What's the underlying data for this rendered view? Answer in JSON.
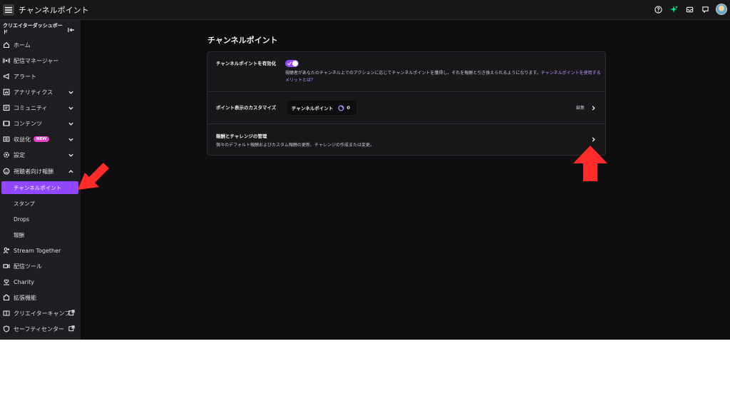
{
  "app": {
    "title": "チャンネルポイント"
  },
  "sidebar": {
    "header": "クリエイターダッシュボード",
    "items": [
      {
        "label": "ホーム"
      },
      {
        "label": "配信マネージャー"
      },
      {
        "label": "アラート"
      },
      {
        "label": "アナリティクス"
      },
      {
        "label": "コミュニティ"
      },
      {
        "label": "コンテンツ"
      },
      {
        "label": "収益化",
        "badge": "NEW"
      },
      {
        "label": "設定"
      },
      {
        "label": "視聴者向け報酬"
      }
    ],
    "sub_items": [
      {
        "label": "チャンネルポイント"
      },
      {
        "label": "スタンプ"
      },
      {
        "label": "Drops"
      },
      {
        "label": "報酬"
      }
    ],
    "items_after": [
      {
        "label": "Stream Together"
      },
      {
        "label": "配信ツール"
      },
      {
        "label": "Charity"
      },
      {
        "label": "拡張機能"
      },
      {
        "label": "クリエイターキャンプ"
      },
      {
        "label": "セーフティセンター"
      }
    ]
  },
  "main": {
    "title": "チャンネルポイント",
    "rows": [
      {
        "label": "チャンネルポイントを有効化",
        "description": "視聴者があなたのチャンネル上でのアクションに応じてチャンネルポイントを獲得し、それを報酬と引き換えられるようになります。",
        "link": "チャンネルポイントを使用するメリットとは？",
        "toggle_on": true
      },
      {
        "label": "ポイント表示のカスタマイズ",
        "preview_name": "チャンネルポイント",
        "preview_value": "0",
        "action": "編集"
      },
      {
        "label": "報酬とチャレンジの管理",
        "description": "個々のデフォルト報酬およびカスタム報酬の更新、チャレンジの作成または変更。"
      }
    ]
  },
  "colors": {
    "accent": "#9147ff",
    "badge": "#eb3ec8",
    "annotation_arrow": "#ff2a2a"
  }
}
